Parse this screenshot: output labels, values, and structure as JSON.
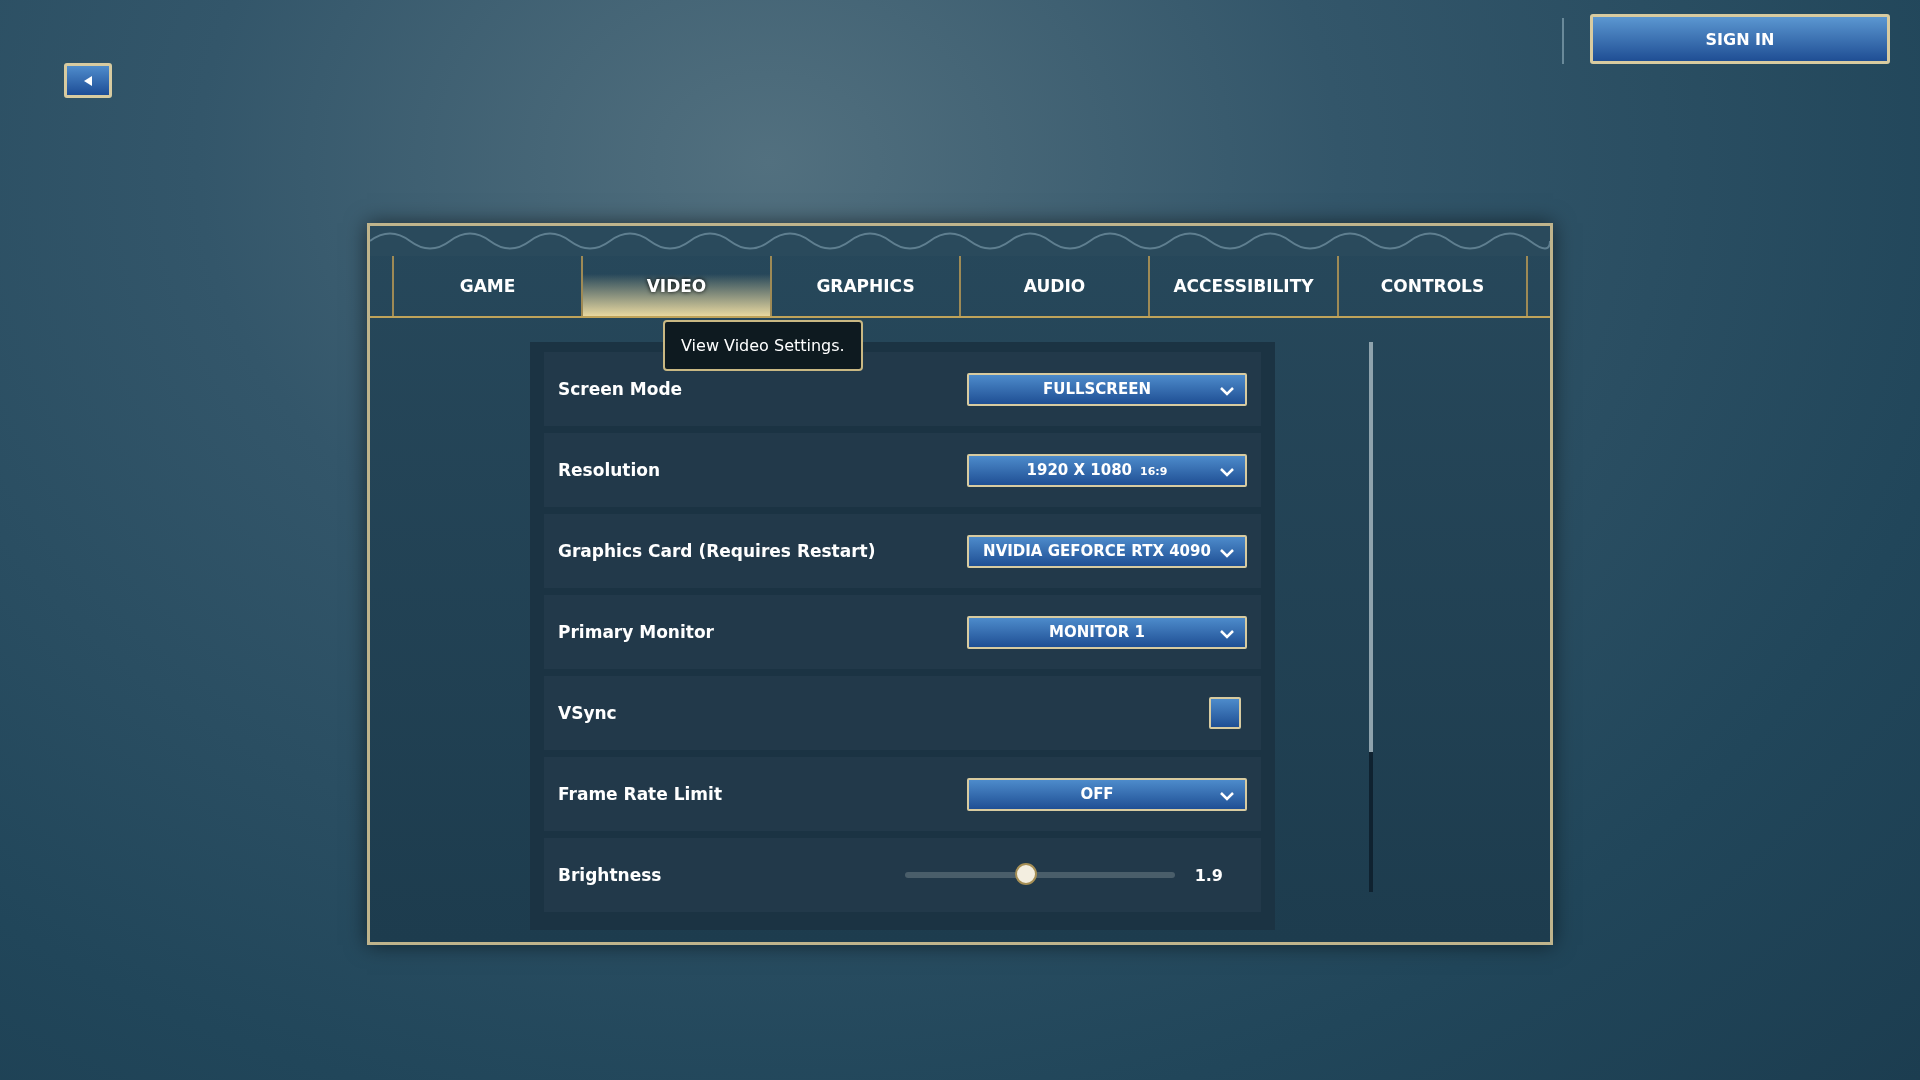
{
  "header": {
    "sign_in": "SIGN IN"
  },
  "tabs": [
    {
      "label": "GAME",
      "selected": false
    },
    {
      "label": "VIDEO",
      "selected": true
    },
    {
      "label": "GRAPHICS",
      "selected": false
    },
    {
      "label": "AUDIO",
      "selected": false
    },
    {
      "label": "ACCESSIBILITY",
      "selected": false
    },
    {
      "label": "CONTROLS",
      "selected": false
    }
  ],
  "tooltip": "View Video Settings.",
  "settings": [
    {
      "kind": "dropdown",
      "label": "Screen Mode",
      "value": "FULLSCREEN"
    },
    {
      "kind": "dropdown",
      "label": "Resolution",
      "value": "1920 X 1080",
      "aspect": "16:9"
    },
    {
      "kind": "dropdown",
      "label": "Graphics Card (Requires Restart)",
      "value": "NVIDIA GEFORCE RTX 4090"
    },
    {
      "kind": "dropdown",
      "label": "Primary Monitor",
      "value": "MONITOR 1"
    },
    {
      "kind": "checkbox",
      "label": "VSync",
      "checked": false
    },
    {
      "kind": "dropdown",
      "label": "Frame Rate Limit",
      "value": "OFF"
    },
    {
      "kind": "slider",
      "label": "Brightness",
      "level": 0.45,
      "reading": "1.9"
    }
  ]
}
